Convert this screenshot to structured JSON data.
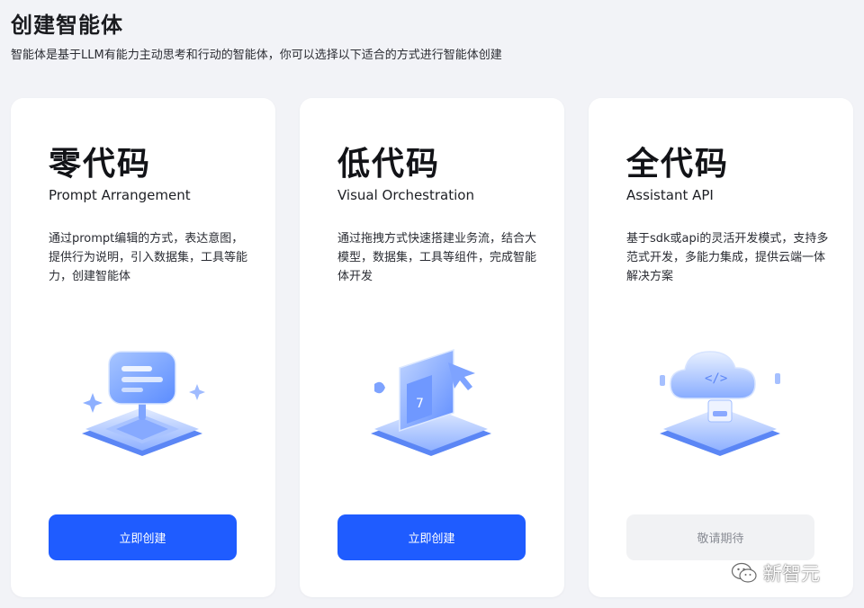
{
  "header": {
    "title": "创建智能体",
    "subtitle": "智能体是基于LLM有能力主动思考和行动的智能体，你可以选择以下适合的方式进行智能体创建"
  },
  "cards": [
    {
      "title": "零代码",
      "subtitle": "Prompt Arrangement",
      "description": "通过prompt编辑的方式，表达意图，提供行为说明，引入数据集，工具等能力，创建智能体",
      "illustration": "chat-bubble-icon",
      "button_label": "立即创建",
      "button_enabled": true
    },
    {
      "title": "低代码",
      "subtitle": "Visual Orchestration",
      "description": "通过拖拽方式快速搭建业务流，结合大模型，数据集，工具等组件，完成智能体开发",
      "illustration": "drag-cursor-icon",
      "button_label": "立即创建",
      "button_enabled": true
    },
    {
      "title": "全代码",
      "subtitle": "Assistant API",
      "description": "基于sdk或api的灵活开发模式，支持多范式开发，多能力集成，提供云端一体解决方案",
      "illustration": "cloud-code-icon",
      "button_label": "敬请期待",
      "button_enabled": false
    }
  ],
  "watermark": {
    "text": "新智元",
    "icon": "wechat-icon"
  },
  "colors": {
    "background": "#f2f3f7",
    "card": "#ffffff",
    "primary_button": "#1f5cff",
    "disabled_button": "#f1f2f4",
    "illustration_blue": "#7ba6ff"
  }
}
